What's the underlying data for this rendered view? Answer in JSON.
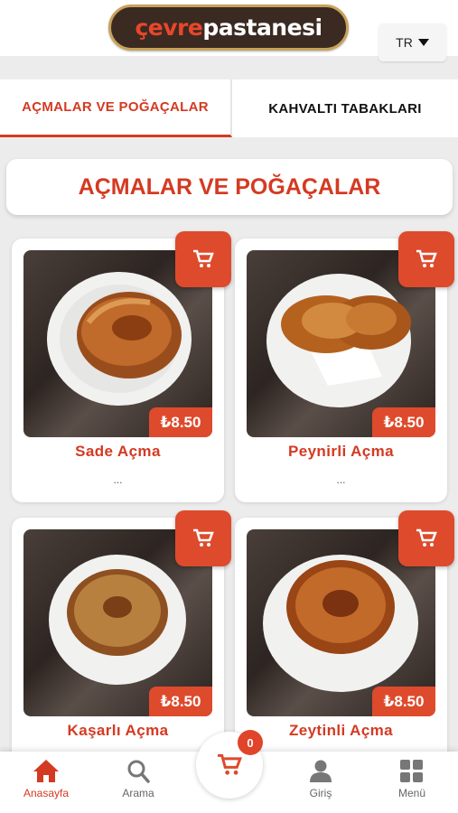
{
  "header": {
    "logo_part1": "çevre",
    "logo_part2": "pastanesi",
    "language": "TR"
  },
  "tabs": [
    {
      "label": "AÇMALAR VE POĞAÇALAR",
      "active": true
    },
    {
      "label": "KAHVALTI TABAKLARI",
      "active": false
    }
  ],
  "section": {
    "title": "AÇMALAR VE POĞAÇALAR"
  },
  "products": [
    {
      "name": "Sade Açma",
      "price": "₺8.50",
      "description": "...",
      "icon": "cart-icon"
    },
    {
      "name": "Peynirli Açma",
      "price": "₺8.50",
      "description": "...",
      "icon": "cart-icon"
    },
    {
      "name": "Kaşarlı Açma",
      "price": "₺8.50",
      "description": "",
      "icon": "cart-icon"
    },
    {
      "name": "Zeytinli Açma",
      "price": "₺8.50",
      "description": "",
      "icon": "cart-icon"
    }
  ],
  "bottom_nav": {
    "home": "Anasayfa",
    "search": "Arama",
    "login": "Giriş",
    "menu": "Menü",
    "cart_count": "0"
  },
  "colors": {
    "accent": "#de4a2c",
    "accent_text": "#d43a22",
    "background": "#ececec"
  }
}
